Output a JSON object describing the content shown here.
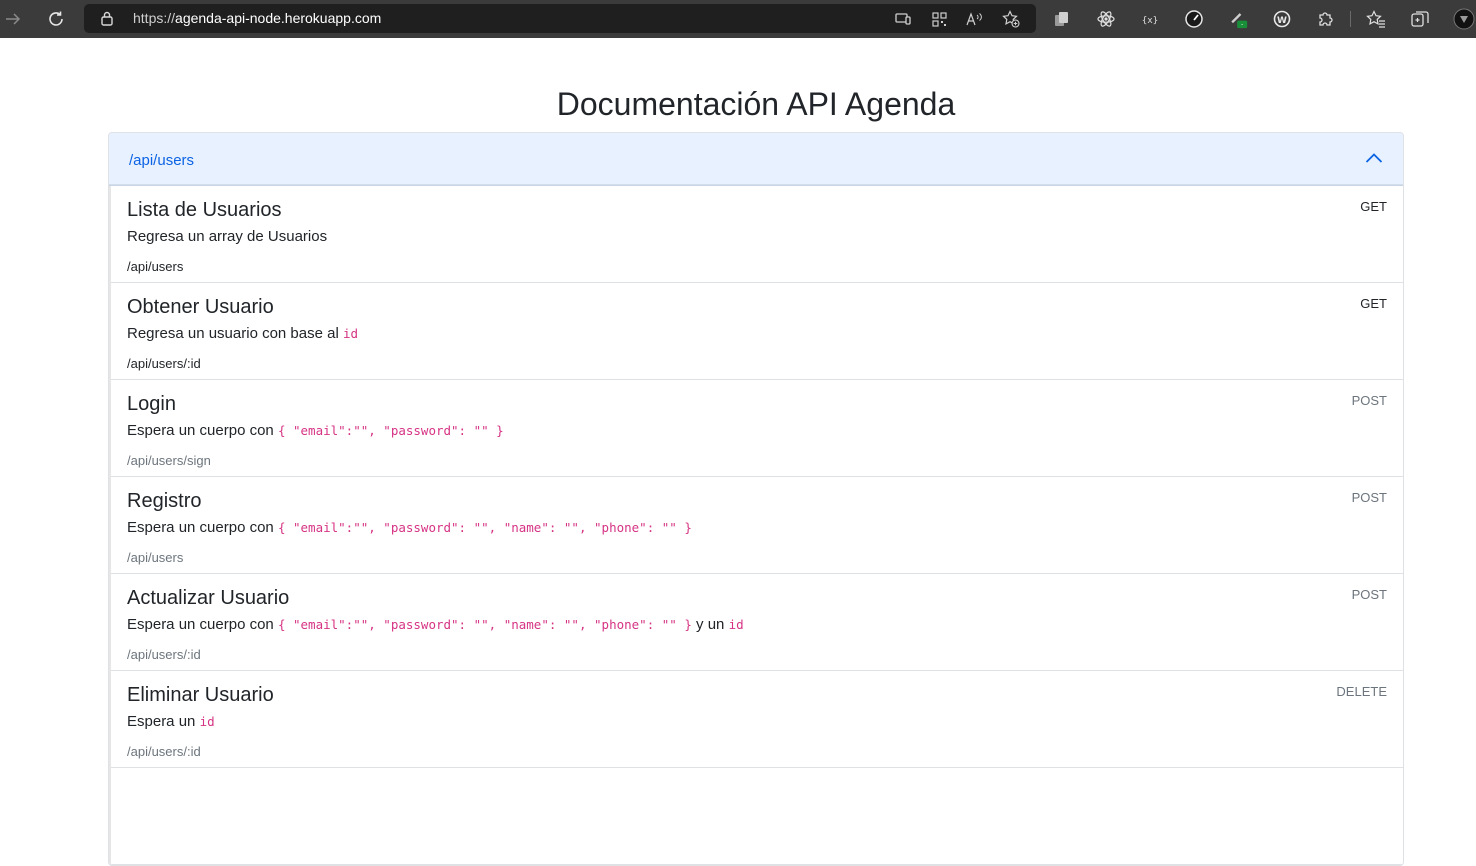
{
  "browser": {
    "url_scheme": "https://",
    "url_host": "agenda-api-node.herokuapp.com"
  },
  "page": {
    "title": "Documentación API Agenda"
  },
  "accordion": {
    "title": "/api/users",
    "expanded": true
  },
  "endpoints": [
    {
      "name": "Lista de Usuarios",
      "desc_text": "Regresa un array de Usuarios",
      "desc_code": "",
      "desc_suffix": "",
      "desc_code2": "",
      "path": "/api/users",
      "method": "GET"
    },
    {
      "name": "Obtener Usuario",
      "desc_text": "Regresa un usuario con base al",
      "desc_code": "id",
      "desc_suffix": "",
      "desc_code2": "",
      "path": "/api/users/:id",
      "method": "GET"
    },
    {
      "name": "Login",
      "desc_text": "Espera un cuerpo con",
      "desc_code": "{ \"email\":\"\", \"password\": \"\" }",
      "desc_suffix": "",
      "desc_code2": "",
      "path": "/api/users/sign",
      "method": "POST"
    },
    {
      "name": "Registro",
      "desc_text": "Espera un cuerpo con",
      "desc_code": "{ \"email\":\"\", \"password\": \"\", \"name\": \"\", \"phone\": \"\" }",
      "desc_suffix": "",
      "desc_code2": "",
      "path": "/api/users",
      "method": "POST"
    },
    {
      "name": "Actualizar Usuario",
      "desc_text": "Espera un cuerpo con",
      "desc_code": "{ \"email\":\"\", \"password\": \"\", \"name\": \"\", \"phone\": \"\" }",
      "desc_suffix": "y un",
      "desc_code2": "id",
      "path": "/api/users/:id",
      "method": "POST"
    },
    {
      "name": "Eliminar Usuario",
      "desc_text": "Espera un",
      "desc_code": "id",
      "desc_suffix": "",
      "desc_code2": "",
      "path": "/api/users/:id",
      "method": "DELETE"
    }
  ],
  "colors": {
    "toolbar_bg": "#3b3b3b",
    "address_bg": "#1f1f1f",
    "accordion_header_bg": "#e7f1ff",
    "accordion_title": "#0c63e4",
    "code": "#d63384",
    "muted": "#6c757d"
  },
  "icons": {
    "back": "arrow-right-icon",
    "refresh": "refresh-icon",
    "lock": "lock-icon",
    "address_bar": [
      "devices-icon",
      "qr-code-icon",
      "read-aloud-icon",
      "favorite-add-icon"
    ],
    "extensions": [
      "collections-ext-icon",
      "react-ext-icon",
      "json-ext-icon",
      "speedometer-ext-icon",
      "pen-ext-icon",
      "wappalyzer-ext-icon",
      "puzzle-extensions-icon",
      "favorites-icon",
      "collections-icon",
      "profile-icon"
    ]
  }
}
